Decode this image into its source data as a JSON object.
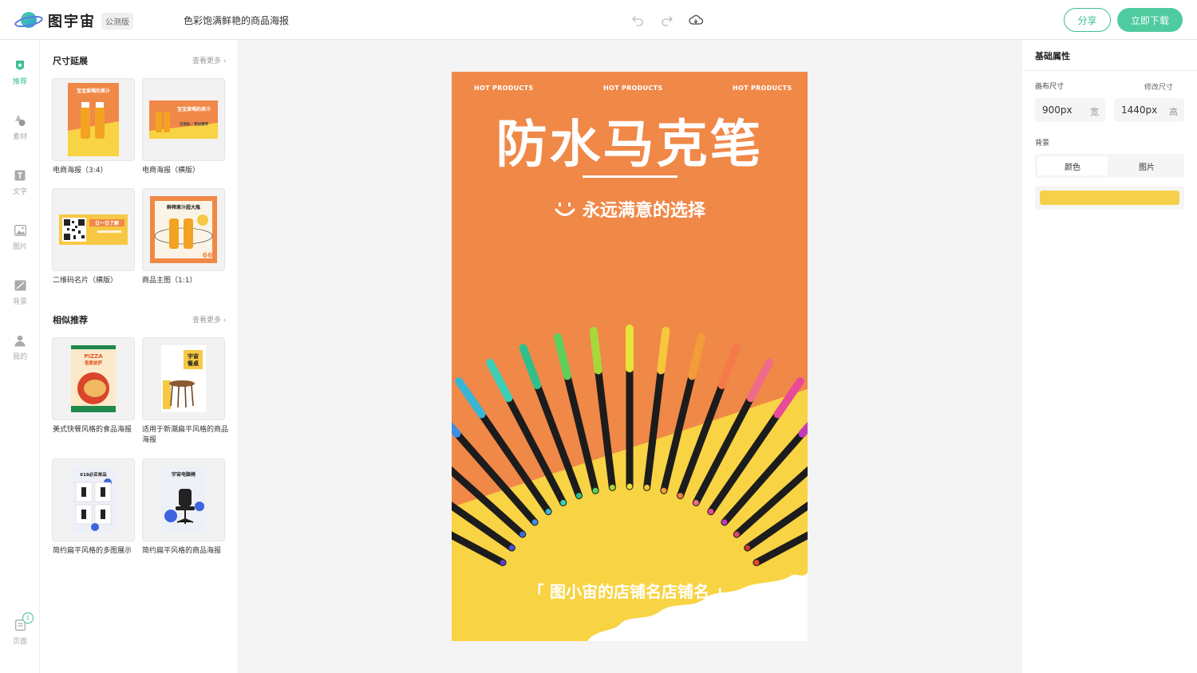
{
  "header": {
    "brand": "图宇宙",
    "badge": "公测版",
    "doc_title": "色彩饱满鲜艳的商品海报",
    "share_label": "分享",
    "download_label": "立即下载"
  },
  "rail": {
    "items": [
      {
        "label": "推荐",
        "icon": "star-badge-icon"
      },
      {
        "label": "素材",
        "icon": "shapes-icon"
      },
      {
        "label": "文字",
        "icon": "text-icon"
      },
      {
        "label": "图片",
        "icon": "image-icon"
      },
      {
        "label": "背景",
        "icon": "background-icon"
      },
      {
        "label": "我的",
        "icon": "user-icon"
      }
    ],
    "pages_label": "页面",
    "pages_count": "1"
  },
  "panel": {
    "size_section": {
      "title": "尺寸延展",
      "more": "查看更多",
      "cards": [
        {
          "label": "电商海报（3:4）"
        },
        {
          "label": "电商海报（横版）"
        },
        {
          "label": "二维码名片（横版）"
        },
        {
          "label": "商品主图（1:1）"
        }
      ]
    },
    "similar_section": {
      "title": "相似推荐",
      "more": "查看更多",
      "cards": [
        {
          "label": "美式快餐风格的食品海报"
        },
        {
          "label": "适用于新潮扁平风格的商品海报"
        },
        {
          "label": "简约扁平风格的多图展示"
        },
        {
          "label": "简约扁平风格的商品海报"
        }
      ]
    },
    "thumbs": {
      "juice_title": "宝宝爱喝的果汁",
      "juice_sub": "无添加 / 更加营养",
      "qr_title": "日一日了解",
      "main_title": "鲜榨果汁超大瓶",
      "main_num": "66",
      "pizza_title": "PIZZA",
      "pizza_sub": "香脆披萨",
      "table_title": "宇宙",
      "table_sub": "餐桌",
      "multi_title": "618必买单品",
      "chair_title": "宇宙电脑椅"
    }
  },
  "canvas": {
    "hot_texts": [
      "HOT PRODUCTS",
      "HOT PRODUCTS",
      "HOT PRODUCTS"
    ],
    "title": "防水马克笔",
    "slogan": "永远满意的选择",
    "shop": "「 图小宙的店铺名店铺名 」",
    "colors": {
      "top": "#f08848",
      "bottom": "#f8d343"
    }
  },
  "props": {
    "title": "基础属性",
    "canvas_size_label": "画布尺寸",
    "edit_size_label": "修改尺寸",
    "width_value": "900px",
    "width_unit": "宽",
    "height_value": "1440px",
    "height_unit": "高",
    "background_label": "背景",
    "tab_color": "颜色",
    "tab_image": "图片",
    "bg_color": "#f6d04a"
  }
}
